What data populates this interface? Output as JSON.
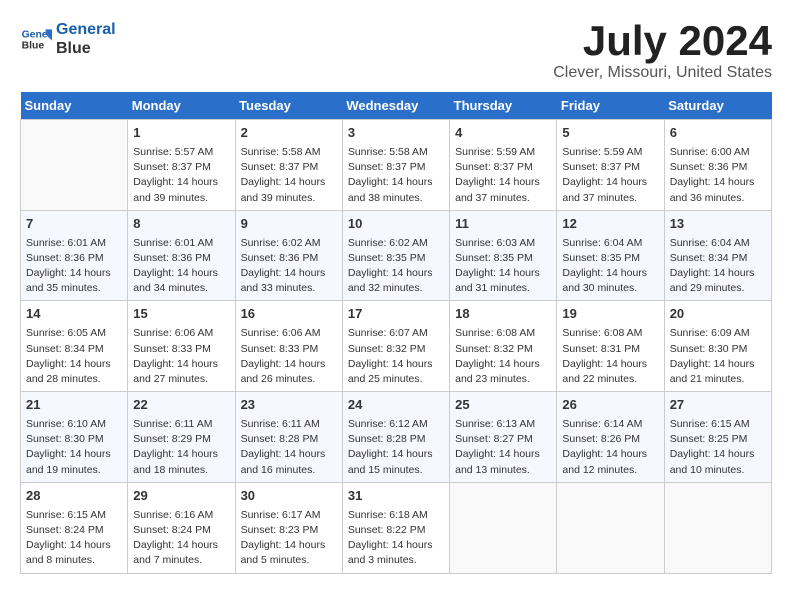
{
  "header": {
    "logo_line1": "General",
    "logo_line2": "Blue",
    "month_year": "July 2024",
    "location": "Clever, Missouri, United States"
  },
  "weekdays": [
    "Sunday",
    "Monday",
    "Tuesday",
    "Wednesday",
    "Thursday",
    "Friday",
    "Saturday"
  ],
  "weeks": [
    [
      {
        "day": "",
        "sunrise": "",
        "sunset": "",
        "daylight": ""
      },
      {
        "day": "1",
        "sunrise": "Sunrise: 5:57 AM",
        "sunset": "Sunset: 8:37 PM",
        "daylight": "Daylight: 14 hours and 39 minutes."
      },
      {
        "day": "2",
        "sunrise": "Sunrise: 5:58 AM",
        "sunset": "Sunset: 8:37 PM",
        "daylight": "Daylight: 14 hours and 39 minutes."
      },
      {
        "day": "3",
        "sunrise": "Sunrise: 5:58 AM",
        "sunset": "Sunset: 8:37 PM",
        "daylight": "Daylight: 14 hours and 38 minutes."
      },
      {
        "day": "4",
        "sunrise": "Sunrise: 5:59 AM",
        "sunset": "Sunset: 8:37 PM",
        "daylight": "Daylight: 14 hours and 37 minutes."
      },
      {
        "day": "5",
        "sunrise": "Sunrise: 5:59 AM",
        "sunset": "Sunset: 8:37 PM",
        "daylight": "Daylight: 14 hours and 37 minutes."
      },
      {
        "day": "6",
        "sunrise": "Sunrise: 6:00 AM",
        "sunset": "Sunset: 8:36 PM",
        "daylight": "Daylight: 14 hours and 36 minutes."
      }
    ],
    [
      {
        "day": "7",
        "sunrise": "Sunrise: 6:01 AM",
        "sunset": "Sunset: 8:36 PM",
        "daylight": "Daylight: 14 hours and 35 minutes."
      },
      {
        "day": "8",
        "sunrise": "Sunrise: 6:01 AM",
        "sunset": "Sunset: 8:36 PM",
        "daylight": "Daylight: 14 hours and 34 minutes."
      },
      {
        "day": "9",
        "sunrise": "Sunrise: 6:02 AM",
        "sunset": "Sunset: 8:36 PM",
        "daylight": "Daylight: 14 hours and 33 minutes."
      },
      {
        "day": "10",
        "sunrise": "Sunrise: 6:02 AM",
        "sunset": "Sunset: 8:35 PM",
        "daylight": "Daylight: 14 hours and 32 minutes."
      },
      {
        "day": "11",
        "sunrise": "Sunrise: 6:03 AM",
        "sunset": "Sunset: 8:35 PM",
        "daylight": "Daylight: 14 hours and 31 minutes."
      },
      {
        "day": "12",
        "sunrise": "Sunrise: 6:04 AM",
        "sunset": "Sunset: 8:35 PM",
        "daylight": "Daylight: 14 hours and 30 minutes."
      },
      {
        "day": "13",
        "sunrise": "Sunrise: 6:04 AM",
        "sunset": "Sunset: 8:34 PM",
        "daylight": "Daylight: 14 hours and 29 minutes."
      }
    ],
    [
      {
        "day": "14",
        "sunrise": "Sunrise: 6:05 AM",
        "sunset": "Sunset: 8:34 PM",
        "daylight": "Daylight: 14 hours and 28 minutes."
      },
      {
        "day": "15",
        "sunrise": "Sunrise: 6:06 AM",
        "sunset": "Sunset: 8:33 PM",
        "daylight": "Daylight: 14 hours and 27 minutes."
      },
      {
        "day": "16",
        "sunrise": "Sunrise: 6:06 AM",
        "sunset": "Sunset: 8:33 PM",
        "daylight": "Daylight: 14 hours and 26 minutes."
      },
      {
        "day": "17",
        "sunrise": "Sunrise: 6:07 AM",
        "sunset": "Sunset: 8:32 PM",
        "daylight": "Daylight: 14 hours and 25 minutes."
      },
      {
        "day": "18",
        "sunrise": "Sunrise: 6:08 AM",
        "sunset": "Sunset: 8:32 PM",
        "daylight": "Daylight: 14 hours and 23 minutes."
      },
      {
        "day": "19",
        "sunrise": "Sunrise: 6:08 AM",
        "sunset": "Sunset: 8:31 PM",
        "daylight": "Daylight: 14 hours and 22 minutes."
      },
      {
        "day": "20",
        "sunrise": "Sunrise: 6:09 AM",
        "sunset": "Sunset: 8:30 PM",
        "daylight": "Daylight: 14 hours and 21 minutes."
      }
    ],
    [
      {
        "day": "21",
        "sunrise": "Sunrise: 6:10 AM",
        "sunset": "Sunset: 8:30 PM",
        "daylight": "Daylight: 14 hours and 19 minutes."
      },
      {
        "day": "22",
        "sunrise": "Sunrise: 6:11 AM",
        "sunset": "Sunset: 8:29 PM",
        "daylight": "Daylight: 14 hours and 18 minutes."
      },
      {
        "day": "23",
        "sunrise": "Sunrise: 6:11 AM",
        "sunset": "Sunset: 8:28 PM",
        "daylight": "Daylight: 14 hours and 16 minutes."
      },
      {
        "day": "24",
        "sunrise": "Sunrise: 6:12 AM",
        "sunset": "Sunset: 8:28 PM",
        "daylight": "Daylight: 14 hours and 15 minutes."
      },
      {
        "day": "25",
        "sunrise": "Sunrise: 6:13 AM",
        "sunset": "Sunset: 8:27 PM",
        "daylight": "Daylight: 14 hours and 13 minutes."
      },
      {
        "day": "26",
        "sunrise": "Sunrise: 6:14 AM",
        "sunset": "Sunset: 8:26 PM",
        "daylight": "Daylight: 14 hours and 12 minutes."
      },
      {
        "day": "27",
        "sunrise": "Sunrise: 6:15 AM",
        "sunset": "Sunset: 8:25 PM",
        "daylight": "Daylight: 14 hours and 10 minutes."
      }
    ],
    [
      {
        "day": "28",
        "sunrise": "Sunrise: 6:15 AM",
        "sunset": "Sunset: 8:24 PM",
        "daylight": "Daylight: 14 hours and 8 minutes."
      },
      {
        "day": "29",
        "sunrise": "Sunrise: 6:16 AM",
        "sunset": "Sunset: 8:24 PM",
        "daylight": "Daylight: 14 hours and 7 minutes."
      },
      {
        "day": "30",
        "sunrise": "Sunrise: 6:17 AM",
        "sunset": "Sunset: 8:23 PM",
        "daylight": "Daylight: 14 hours and 5 minutes."
      },
      {
        "day": "31",
        "sunrise": "Sunrise: 6:18 AM",
        "sunset": "Sunset: 8:22 PM",
        "daylight": "Daylight: 14 hours and 3 minutes."
      },
      {
        "day": "",
        "sunrise": "",
        "sunset": "",
        "daylight": ""
      },
      {
        "day": "",
        "sunrise": "",
        "sunset": "",
        "daylight": ""
      },
      {
        "day": "",
        "sunrise": "",
        "sunset": "",
        "daylight": ""
      }
    ]
  ]
}
